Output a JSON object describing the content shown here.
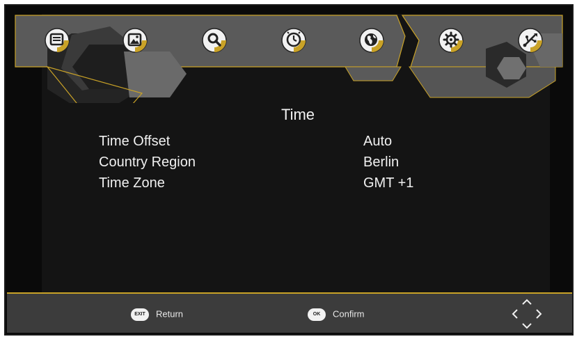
{
  "menu": {
    "items": [
      {
        "name": "program",
        "icon": "tv-list-icon"
      },
      {
        "name": "picture",
        "icon": "picture-icon"
      },
      {
        "name": "search",
        "icon": "search-icon"
      },
      {
        "name": "time",
        "icon": "clock-icon",
        "selected": true
      },
      {
        "name": "option",
        "icon": "globe-icon"
      },
      {
        "name": "system",
        "icon": "gear-icon"
      },
      {
        "name": "usb",
        "icon": "usb-icon"
      }
    ]
  },
  "page": {
    "title": "Time"
  },
  "settings": [
    {
      "label": "Time Offset",
      "value": "Auto"
    },
    {
      "label": "Country Region",
      "value": "Berlin"
    },
    {
      "label": "Time Zone",
      "value": "GMT +1"
    }
  ],
  "footer": {
    "exit_key": "EXIT",
    "exit_label": "Return",
    "ok_key": "OK",
    "ok_label": "Confirm",
    "nav_icon": "directional-arrows-icon"
  },
  "colors": {
    "accent": "#c9a227",
    "background": "#0a0a0a",
    "panel": "#141414",
    "footer": "#3c3c3c"
  }
}
